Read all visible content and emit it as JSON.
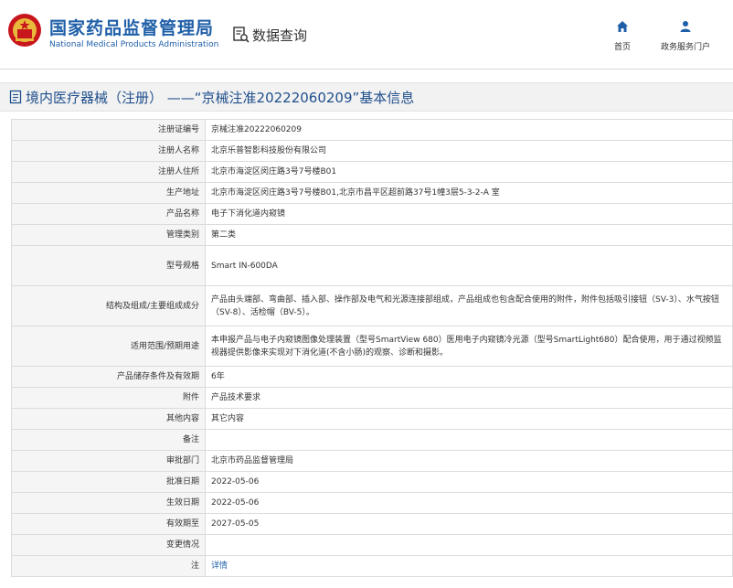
{
  "header": {
    "brand_cn": "国家药品监督管理局",
    "brand_en": "National Medical Products Administration",
    "query_label": "数据查询",
    "nav": [
      {
        "label": "首页",
        "icon": "home-icon"
      },
      {
        "label": "政务服务门户",
        "icon": "user-icon"
      }
    ]
  },
  "page_title": "境内医疗器械（注册） ——“京械注准20222060209”基本信息",
  "colors": {
    "brand": "#1f5fa8",
    "title": "#1f4f8c",
    "label_bg": "#f5f5f5"
  },
  "rows": [
    {
      "label": "注册证编号",
      "value": "京械注准20222060209"
    },
    {
      "label": "注册人名称",
      "value": "北京乐普智影科技股份有限公司"
    },
    {
      "label": "注册人住所",
      "value": "北京市海淀区闵庄路3号7号楼B01"
    },
    {
      "label": "生产地址",
      "value": "北京市海淀区闵庄路3号7号楼B01,北京市昌平区超前路37号1幢3层5-3-2-A 室"
    },
    {
      "label": "产品名称",
      "value": "电子下消化道内窥镜"
    },
    {
      "label": "管理类别",
      "value": "第二类"
    },
    {
      "label": "型号规格",
      "value": "Smart IN-600DA"
    },
    {
      "label": "结构及组成/主要组成成分",
      "value": "产品由头端部、弯曲部、插入部、操作部及电气和光源连接部组成，产品组成也包含配合使用的附件，附件包括吸引接钮（SV-3）、水气按钮（SV-8）、活检帽（BV-5）。"
    },
    {
      "label": "适用范围/预期用途",
      "value": "本申报产品与电子内窥镜图像处理装置（型号SmartView 680）医用电子内窥镜冷光源（型号SmartLight680）配合使用，用于通过视频监视器提供影像来实现对下消化道(不含小肠)的观察、诊断和摄影。"
    },
    {
      "label": "产品储存条件及有效期",
      "value": "6年"
    },
    {
      "label": "附件",
      "value": "产品技术要求"
    },
    {
      "label": "其他内容",
      "value": "其它内容"
    },
    {
      "label": "备注",
      "value": ""
    },
    {
      "label": "审批部门",
      "value": "北京市药品监督管理局"
    },
    {
      "label": "批准日期",
      "value": "2022-05-06"
    },
    {
      "label": "生效日期",
      "value": "2022-05-06"
    },
    {
      "label": "有效期至",
      "value": "2027-05-05"
    },
    {
      "label": "变更情况",
      "value": ""
    },
    {
      "label": "注",
      "value": "详情",
      "link": true
    }
  ]
}
